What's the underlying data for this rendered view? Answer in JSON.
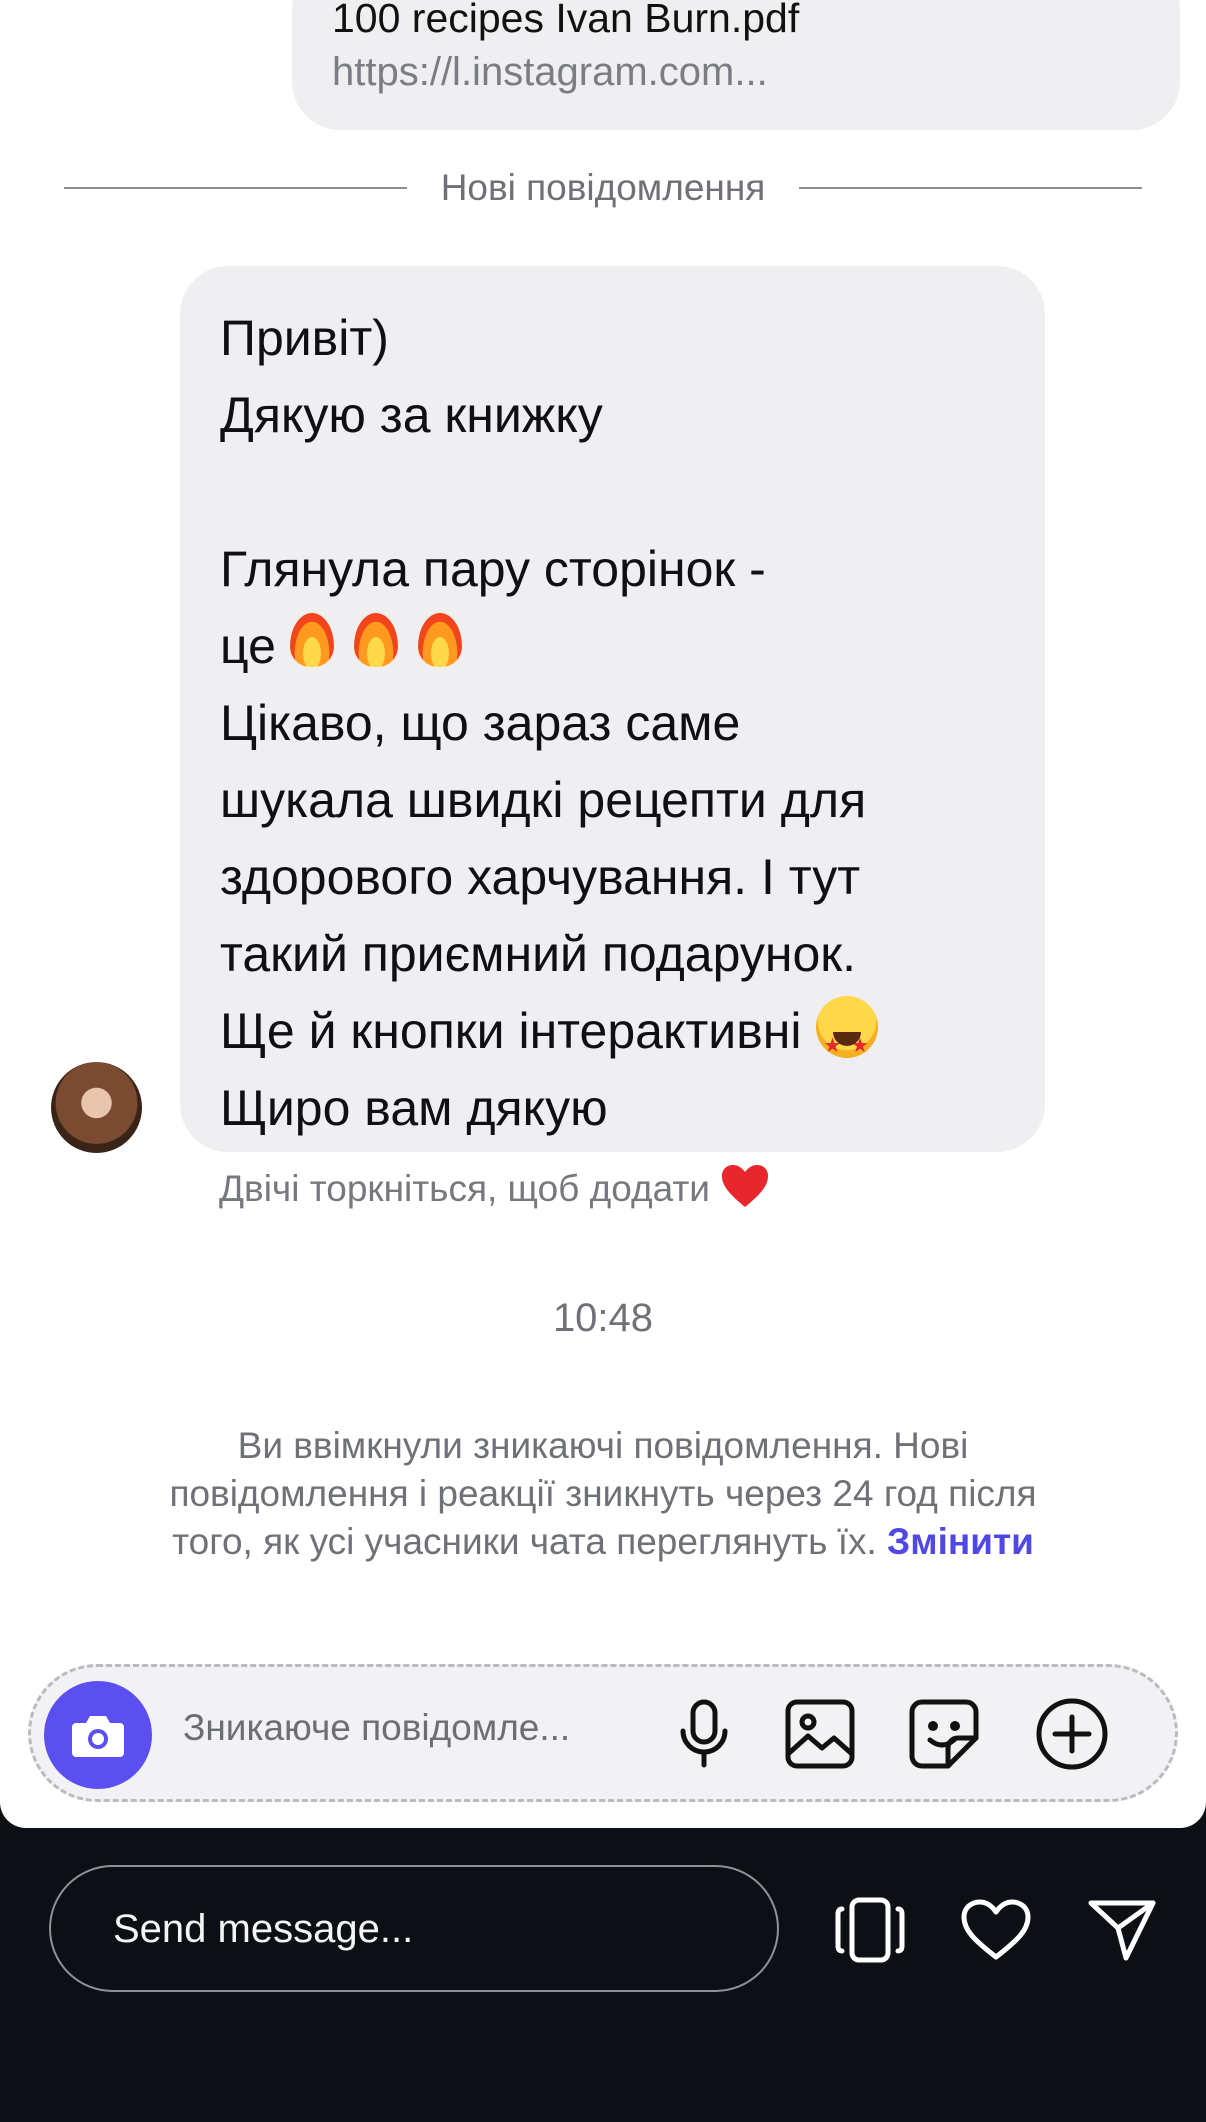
{
  "shared_file": {
    "title": "100 recipes Ivan Burn.pdf",
    "link": "https://l.instagram.com..."
  },
  "divider_label": "Нові повідомлення",
  "message": {
    "lines": [
      "Привіт)",
      "Дякую за книжку",
      "",
      "Глянула пару сторінок -",
      "це",
      "Цікаво, що зараз саме",
      "шукала швидкі рецепти для",
      "здорового харчування. І тут",
      "такий приємний подарунок.",
      "Ще й кнопки інтерактивні",
      "Щиро вам дякую"
    ],
    "emojis": [
      "fire-emoji",
      "fire-emoji",
      "fire-emoji",
      "star-struck-emoji"
    ]
  },
  "reaction_hint": "Двічі торкніться, щоб додати",
  "timestamp": "10:48",
  "vanish_notice": {
    "text": "Ви ввімкнули зникаючі повідомлення. Нові повідомлення і реакції зникнуть через 24 год після того, як усі учасники чата переглянуть їх.",
    "link": "Змінити"
  },
  "composer": {
    "placeholder": "Зникаюче повідомле...",
    "icons": [
      "camera-icon",
      "microphone-icon",
      "gallery-icon",
      "sticker-icon",
      "plus-icon"
    ]
  },
  "story_bar": {
    "placeholder": "Send message...",
    "icons": [
      "carousel-icon",
      "heart-icon",
      "send-icon"
    ]
  },
  "colors": {
    "accent": "#5c4ff0",
    "link": "#5048e5",
    "bubble": "#efeff2",
    "dark_bar": "#0c1014"
  }
}
